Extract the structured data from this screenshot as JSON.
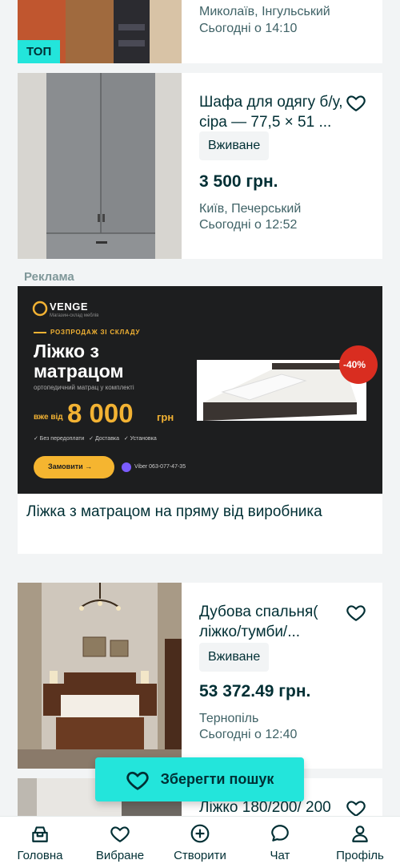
{
  "listings": [
    {
      "title": "",
      "location": "Миколаїв, Інгульський",
      "date": "Сьогодні о 14:10",
      "tag": "ТОП"
    },
    {
      "title": "Шафа для одягу б/у, сіра — 77,5 × 51 ...",
      "condition": "Вживане",
      "price": "3 500 грн.",
      "location": "Київ, Печерський",
      "date": "Сьогодні о 12:52"
    },
    {
      "title": "Дубова спальня( ліжко/тумби/...",
      "condition": "Вживане",
      "price": "53 372.49 грн.",
      "location": "Тернопіль",
      "date": "Сьогодні о 12:40"
    },
    {
      "title": "Ліжко 180/200/ 200"
    }
  ],
  "ad": {
    "label": "Реклама",
    "text": "Ліжка з матрацом на пряму від виробника",
    "banner": {
      "brand": "VENGE",
      "brand_sub": "Магазин-склад меблів",
      "kicker": "РОЗПРОДАЖ ЗІ СКЛАДУ",
      "headline_1": "Ліжко з",
      "headline_2": "матрацом",
      "subline": "ортопедичний матрац у комплекті",
      "price_prefix": "вже від",
      "price": "8 000",
      "currency": "грн",
      "features": "✓ Без передоплати   ✓ Доставка   ✓ Установка",
      "cta": "Замовити →",
      "contact": "Viber 063-077-47-35",
      "discount": "-40%"
    }
  },
  "save_search": {
    "label": "Зберегти пошук"
  },
  "nav": {
    "home": "Головна",
    "favorites": "Вибране",
    "create": "Створити",
    "chat": "Чат",
    "profile": "Профіль"
  },
  "colors": {
    "accent": "#23e5db",
    "text": "#002f34",
    "muted": "#406367",
    "background": "#f2f4f5"
  }
}
